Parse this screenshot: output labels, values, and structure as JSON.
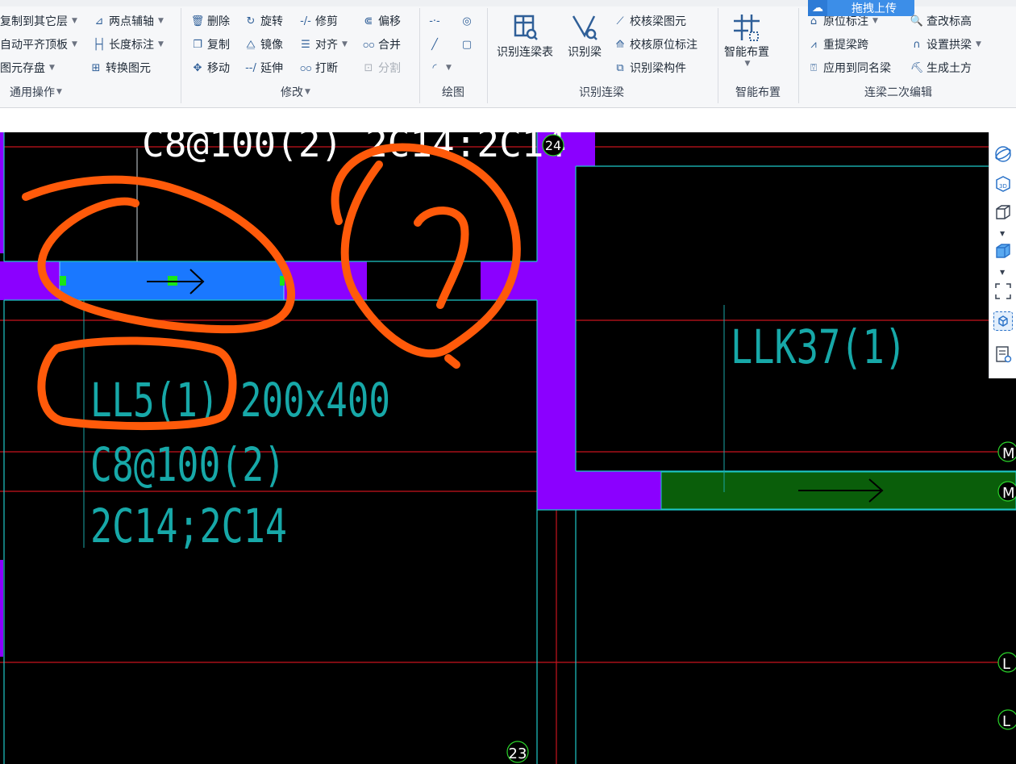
{
  "ribbon": {
    "general": {
      "items": [
        "复制到其它层",
        "两点辅轴",
        "自动平齐顶板",
        "长度标注",
        "图元存盘",
        "转换图元"
      ],
      "group_label": "通用操作"
    },
    "modify": {
      "items": [
        "删除",
        "旋转",
        "修剪",
        "偏移",
        "复制",
        "镜像",
        "对齐",
        "合并",
        "移动",
        "延伸",
        "打断",
        "分割"
      ],
      "group_label": "修改"
    },
    "draw": {
      "group_label": "绘图"
    },
    "identify": {
      "big_items": [
        "识别连梁表",
        "识别梁"
      ],
      "items": [
        "校核梁图元",
        "校核原位标注",
        "识别梁构件"
      ],
      "group_label": "识别连梁"
    },
    "smart": {
      "big_item": "智能布置",
      "group_label": "智能布置"
    },
    "secondary": {
      "items": [
        "原位标注",
        "查改标高",
        "重提梁跨",
        "设置拱梁",
        "应用到同名梁",
        "生成土方"
      ],
      "group_label": "连梁二次编辑"
    },
    "upload_button": "拖拽上传"
  },
  "cad": {
    "top_annotation": "C8@100(2) 2C14:2C14",
    "top_grid_label": "24",
    "bottom_grid_label": "23",
    "beam_label_line1": "LL5(1) 200x400",
    "beam_label_line2": "C8@100(2)",
    "beam_label_line3": "2C14;2C14",
    "right_beam_label": "LLK37(1)",
    "markup_question": "?",
    "edge_markers": [
      "M",
      "M",
      "L",
      "L"
    ]
  },
  "colors": {
    "selected_beam": "#1a78ff",
    "beam": "#8b00ff",
    "green_beam": "#0a5e0a",
    "annotation_markup": "#ff5a0a",
    "cad_line_cyan": "#1ec8c8",
    "cad_grid_red": "#c8141e"
  },
  "right_toolbar": {
    "icons": [
      "orbit-icon",
      "3d-view-icon",
      "cube-view-icon",
      "display-mode-icon",
      "fit-view-icon",
      "component-view-icon",
      "properties-icon"
    ]
  }
}
